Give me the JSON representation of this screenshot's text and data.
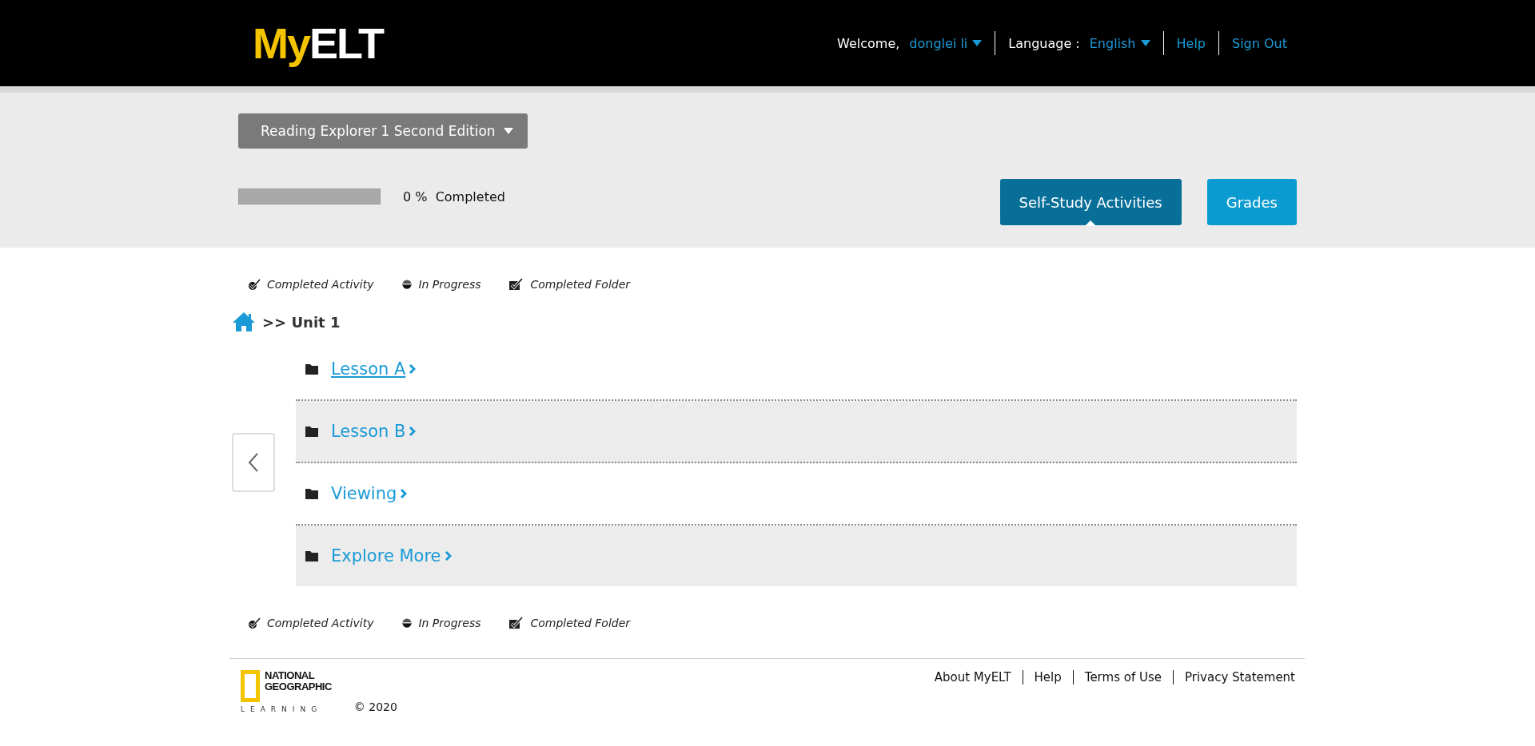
{
  "header": {
    "logo": {
      "part_1": "My",
      "part_2": "ELT"
    },
    "welcome_label": "Welcome,",
    "user": "donglei li",
    "language_label": "Language :",
    "language": "English",
    "links": [
      "Help",
      "Sign Out"
    ]
  },
  "course": {
    "title": "Reading Explorer 1 Second Edition",
    "progress": {
      "level": 0,
      "reading": "0 %",
      "label": "Completed"
    }
  },
  "tabs": [
    {
      "label": "Self-Study Activities",
      "selected": true
    },
    {
      "label": "Grades",
      "selected": false
    }
  ],
  "legend_top": [
    {
      "kind": "activity",
      "label": "Completed Activity"
    },
    {
      "kind": "progress",
      "label": "In Progress"
    },
    {
      "kind": "folder",
      "label": "Completed Folder"
    }
  ],
  "breadcrumb": {
    "separator": ">>",
    "current": "Unit 1"
  },
  "folders": [
    {
      "label": "Lesson A",
      "selected": true
    },
    {
      "label": "Lesson B",
      "selected": false
    },
    {
      "label": "Viewing",
      "selected": false
    },
    {
      "label": "Explore More",
      "selected": false
    }
  ],
  "legend_bottom": [
    {
      "kind": "activity",
      "label": "Completed Activity"
    },
    {
      "kind": "progress",
      "label": "In Progress"
    },
    {
      "kind": "folder",
      "label": "Completed Folder"
    }
  ],
  "footer": {
    "logo": {
      "line_1": "NATIONAL",
      "line_2": "GEOGRAPHIC",
      "line_3": "LEARNING"
    },
    "copyright": "© 2020",
    "links": [
      "About MyELT",
      "Help",
      "Terms of Use",
      "Privacy Statement"
    ]
  }
}
